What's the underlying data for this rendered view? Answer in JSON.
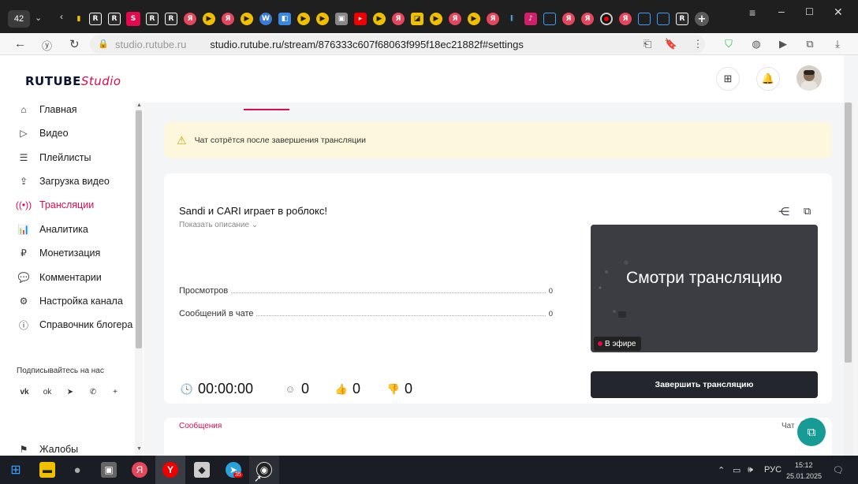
{
  "browser": {
    "tab_count": "42",
    "address_host": "studio.rutube.ru",
    "address_path": "studio.rutube.ru/stream/876333c607f68063f995f18ec21882f#settings"
  },
  "header": {
    "logo_main": "RUTUBE",
    "logo_sub": "Studio"
  },
  "sidebar": {
    "items": [
      {
        "label": "Главная",
        "icon": "home-icon"
      },
      {
        "label": "Видео",
        "icon": "video-icon"
      },
      {
        "label": "Плейлисты",
        "icon": "playlist-icon"
      },
      {
        "label": "Загрузка видео",
        "icon": "upload-icon"
      },
      {
        "label": "Трансляции",
        "icon": "broadcast-icon",
        "active": true
      },
      {
        "label": "Аналитика",
        "icon": "analytics-icon"
      },
      {
        "label": "Монетизация",
        "icon": "money-icon"
      },
      {
        "label": "Комментарии",
        "icon": "comment-icon"
      },
      {
        "label": "Настройка канала",
        "icon": "gear-icon"
      },
      {
        "label": "Справочник блогера",
        "icon": "help-icon"
      }
    ],
    "subscribe_label": "Подписывайтесь на нас",
    "social": [
      "vk-icon",
      "ok-icon",
      "telegram-icon",
      "viber-icon",
      "plus-icon"
    ],
    "bottom_item": "Жалобы"
  },
  "main": {
    "warning": "Чат сотрётся после завершения трансляции",
    "title": "Sandi и CARI играет в роблокс!",
    "show_description": "Показать описание",
    "stats": [
      {
        "label": "Просмотров",
        "value": "0"
      },
      {
        "label": "Сообщений в чате",
        "value": "0"
      }
    ],
    "thumbnail_text": "Смотри трансляцию",
    "live_badge": "В эфире",
    "end_button": "Завершить трансляцию",
    "timer": "00:00:00",
    "viewers": "0",
    "likes": "0",
    "dislikes": "0",
    "messages_tab": "Сообщения",
    "chat_label": "Чат"
  },
  "taskbar": {
    "lang": "РУС",
    "time": "15:12",
    "date": "25.01.2025",
    "telegram_badge": "35"
  },
  "colors": {
    "brand": "#e3094d",
    "dark_button": "#23262d",
    "warning_bg": "#fdf8dd"
  }
}
